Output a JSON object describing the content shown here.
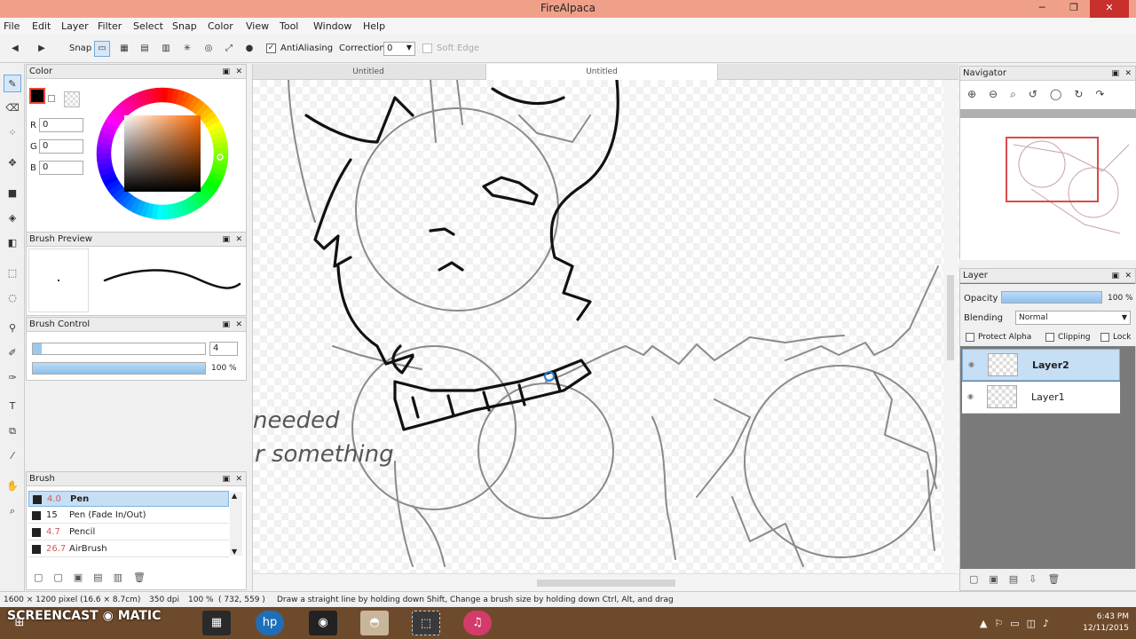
{
  "window": {
    "title": "FireAlpaca",
    "minimize": "─",
    "maximize": "❐",
    "close": "✕"
  },
  "menu": [
    "File",
    "Edit",
    "Layer",
    "Filter",
    "Select",
    "Snap",
    "Color",
    "View",
    "Tool",
    "Window",
    "Help"
  ],
  "toolbar": {
    "snap_label": "Snap",
    "antialiasing_label": "AntiAliasing",
    "antialiasing_checked": true,
    "correction_label": "Correction",
    "correction_value": "0",
    "soft_edge_label": "Soft Edge"
  },
  "tabs": [
    "Untitled",
    "Untitled"
  ],
  "color_panel": {
    "title": "Color",
    "r_label": "R",
    "r_value": "0",
    "g_label": "G",
    "g_value": "0",
    "b_label": "B",
    "b_value": "0"
  },
  "brush_preview": {
    "title": "Brush Preview"
  },
  "brush_control": {
    "title": "Brush Control",
    "size_value": "4",
    "opacity_value": "100 %"
  },
  "brush_panel": {
    "title": "Brush",
    "items": [
      {
        "size": "4.0",
        "name": "Pen",
        "selected": true
      },
      {
        "size": "15",
        "name": "Pen (Fade In/Out)",
        "selected": false
      },
      {
        "size": "4.7",
        "name": "Pencil",
        "selected": false
      },
      {
        "size": "26.7",
        "name": "AirBrush",
        "selected": false
      }
    ]
  },
  "navigator": {
    "title": "Navigator"
  },
  "layer_panel": {
    "title": "Layer",
    "opacity_label": "Opacity",
    "opacity_value": "100 %",
    "blending_label": "Blending",
    "blending_value": "Normal",
    "protect_alpha_label": "Protect Alpha",
    "clipping_label": "Clipping",
    "lock_label": "Lock",
    "layers": [
      {
        "name": "Layer2",
        "selected": true
      },
      {
        "name": "Layer1",
        "selected": false
      }
    ]
  },
  "canvas": {
    "annotation_line1": "needed",
    "annotation_line2": "r something"
  },
  "status": {
    "size": "1600 × 1200 pixel (16.6 × 8.7cm)",
    "dpi": "350 dpi",
    "zoom": "100 %",
    "cursor": "( 732, 559 )",
    "hint": "Draw a straight line by holding down Shift, Change a brush size by holding down Ctrl, Alt, and drag"
  },
  "taskbar": {
    "overlay": "SCREENCAST ◉ MATIC",
    "time": "6:43 PM",
    "date": "12/11/2015"
  },
  "colors": {
    "accent": "#c6dff5",
    "titlebar": "#f0a088",
    "taskbar": "#6e4a2c"
  }
}
